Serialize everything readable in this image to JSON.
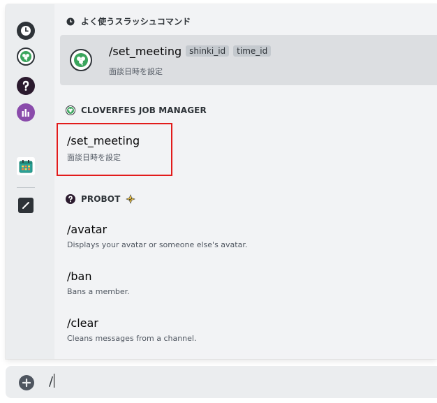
{
  "frequent": {
    "header": "よく使うスラッシュコマンド",
    "selected": {
      "name": "/set_meeting",
      "options": [
        "shinki_id",
        "time_id"
      ],
      "description": "面談日時を設定"
    }
  },
  "sections": [
    {
      "header": "CLOVERFES JOB MANAGER",
      "commands": [
        {
          "name": "/set_meeting",
          "description": "面談日時を設定"
        }
      ]
    },
    {
      "header": "PROBOT",
      "commands": [
        {
          "name": "/avatar",
          "description": "Displays your avatar or someone else's avatar."
        },
        {
          "name": "/ban",
          "description": "Bans a member."
        },
        {
          "name": "/clear",
          "description": "Cleans messages from a channel."
        }
      ]
    }
  ],
  "rail": [
    {
      "icon": "clock-icon",
      "color": "#2e3338"
    },
    {
      "icon": "clover-icon",
      "color": "#3ba55d"
    },
    {
      "icon": "probot-icon",
      "color": "#2b1a2e"
    },
    {
      "icon": "bar-chart-icon",
      "color": "#6e3a8c"
    },
    {
      "icon": "calendar-icon",
      "color": "#1f8a7a"
    },
    {
      "icon": "slash-command-icon",
      "color": "#2e3338"
    }
  ],
  "input": {
    "value": "/"
  },
  "colors": {
    "highlight": "#e21b1b",
    "selected_bg": "#dcdee1",
    "popup_bg": "#f2f3f5"
  }
}
